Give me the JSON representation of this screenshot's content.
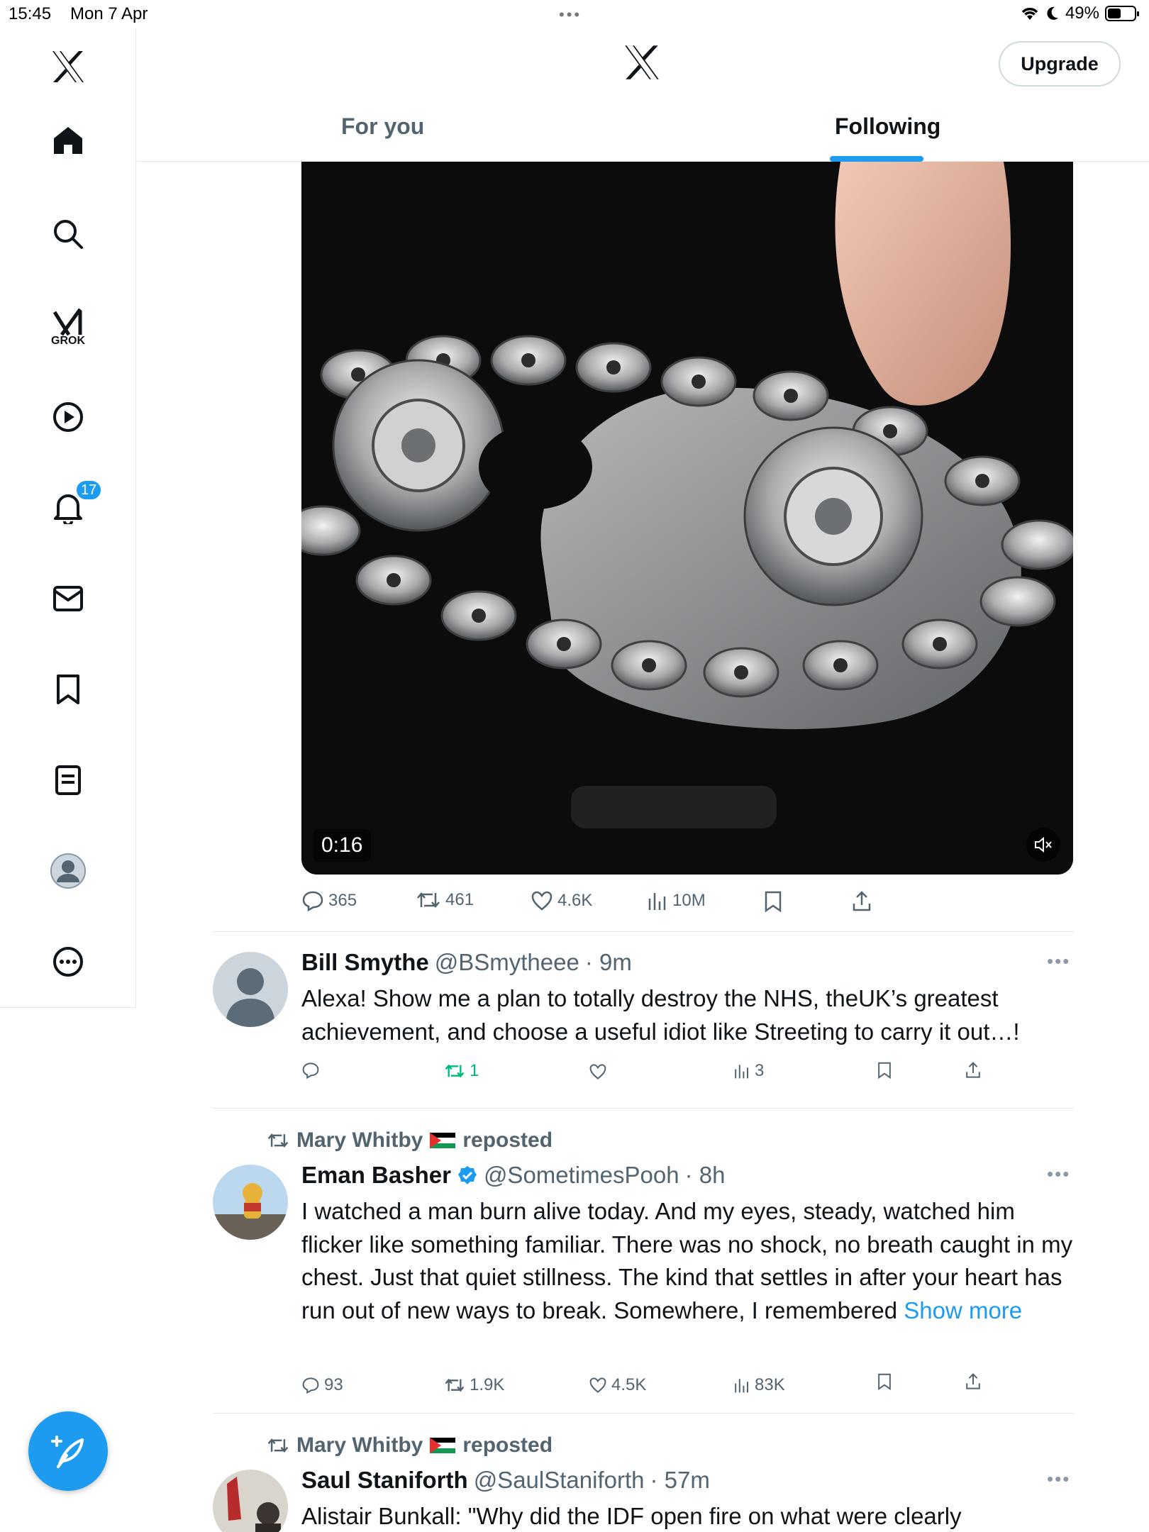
{
  "status_bar": {
    "time": "15:45",
    "date": "Mon 7 Apr",
    "battery": "49%",
    "battery_level": 0.49
  },
  "sidebar": {
    "items": [
      "home",
      "explore",
      "grok",
      "videos",
      "notifications",
      "messages",
      "bookmarks",
      "lists",
      "profile",
      "more"
    ],
    "grok_label": "GROK",
    "notification_count": "17"
  },
  "header": {
    "upgrade_label": "Upgrade",
    "tabs": [
      {
        "label": "For you",
        "active": false
      },
      {
        "label": "Following",
        "active": true
      }
    ]
  },
  "colors": {
    "accent": "#1d9bf0",
    "secondary_text": "#536471",
    "repost_green": "#00ba7c"
  },
  "feed": {
    "video_post": {
      "duration": "0:16",
      "stats": {
        "replies": "365",
        "reposts": "461",
        "likes": "4.6K",
        "views": "10M"
      }
    },
    "posts": [
      {
        "name": "Bill Smythe",
        "handle": "@BSmytheee",
        "time": "· 9m",
        "text": "Alexa! Show me a plan to totally destroy the NHS, theUK’s greatest achievement, and choose a useful idiot like Streeting to carry it out…!",
        "stats": {
          "replies": "",
          "reposts": "1",
          "likes": "",
          "views": "3"
        }
      },
      {
        "repost_by": "Mary Whitby",
        "repost_label": "reposted",
        "name": "Eman Basher",
        "verified": true,
        "handle": "@SometimesPooh",
        "time": "· 8h",
        "text": "I watched a man burn alive today. And my eyes, steady, watched him flicker like something familiar. There was no shock, no breath caught in my chest. Just that quiet stillness. The kind that settles in after your heart has run out of new ways to break. Somewhere, I remembered",
        "show_more": "Show more",
        "stats": {
          "replies": "93",
          "reposts": "1.9K",
          "likes": "4.5K",
          "views": "83K"
        }
      },
      {
        "repost_by": "Mary Whitby",
        "repost_label": "reposted",
        "name": "Saul Staniforth",
        "handle": "@SaulStaniforth",
        "time": "· 57m",
        "text": "Alistair Bunkall: \"Why did the IDF open fire on what were clearly"
      }
    ]
  }
}
